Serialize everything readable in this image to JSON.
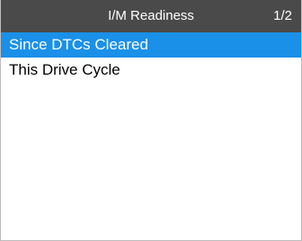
{
  "header": {
    "title": "I/M Readiness",
    "page_indicator": "1/2"
  },
  "menu": {
    "items": [
      {
        "label": "Since DTCs Cleared",
        "selected": true
      },
      {
        "label": "This Drive Cycle",
        "selected": false
      }
    ]
  },
  "colors": {
    "title_bar": "#4a4a4a",
    "selection_highlight": "#1a90e8"
  }
}
